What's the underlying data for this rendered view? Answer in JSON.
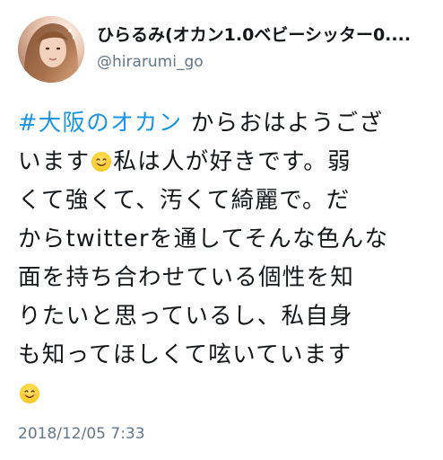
{
  "user": {
    "display_name": "ひらるみ(オカン1.0ベビーシッター0....",
    "handle": "@hirarumi_go"
  },
  "tweet": {
    "line1_hashtag": "#大阪のオカン",
    "line1_rest": " からおはようござ",
    "line2_a": "います",
    "line2_b": "私は人が好きです。弱",
    "line3": "くて強くて、汚くて綺麗で。だ",
    "line4": "からtwitterを通してそんな色んな",
    "line5": "面を持ち合わせている個性を知",
    "line6": "りたいと思っているし、私自身",
    "line7": "も知ってほしくて呟いています",
    "emoji_1": "smiling-face-emoji",
    "emoji_2": "smiling-face-emoji"
  },
  "timestamp": "2018/12/05 7:33",
  "colors": {
    "hashtag": "#1b95e0",
    "secondary_text": "#657786",
    "primary_text": "#14171a"
  }
}
